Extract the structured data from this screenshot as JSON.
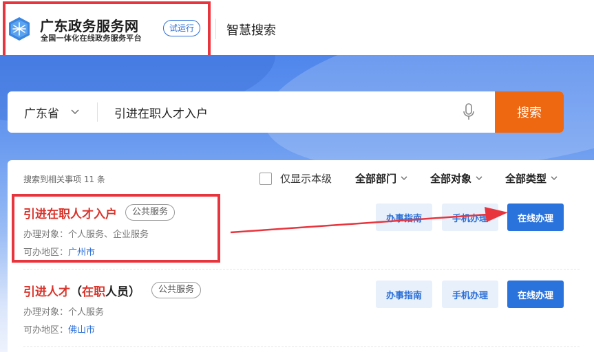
{
  "header": {
    "logo_title": "广东政务服务网",
    "logo_subtitle": "全国一体化在线政务服务平台",
    "trial_badge": "试运行",
    "section": "智慧搜索"
  },
  "search": {
    "region": "广东省",
    "query": "引进在职人才入户",
    "button_label": "搜索"
  },
  "results": {
    "count_text": "搜索到相关事项 11 条",
    "only_this_level_label": "仅显示本级",
    "filters": [
      "全部部门",
      "全部对象",
      "全部类型"
    ],
    "items": [
      {
        "title": "引进在职人才入户",
        "tag": "公共服务",
        "target_label": "办理对象：",
        "target": "个人服务、企业服务",
        "region_label": "可办地区：",
        "region": "广州市",
        "guide_button": "办事指南",
        "mobile_button": "手机办理",
        "online_button": "在线办理"
      },
      {
        "title_part1": "引进人才",
        "title_part2": "（",
        "title_part3": "在职",
        "title_part4": "人员）",
        "tag": "公共服务",
        "target_label": "办理对象：",
        "target": "个人服务",
        "region_label": "可办地区：",
        "region": "佛山市",
        "guide_button": "办事指南",
        "mobile_button": "手机办理",
        "online_button": "在线办理"
      }
    ]
  },
  "colors": {
    "brand_blue": "#2b73dc",
    "search_orange": "#ee6711",
    "highlight_red": "#e8343d",
    "title_red": "#d9342b"
  }
}
